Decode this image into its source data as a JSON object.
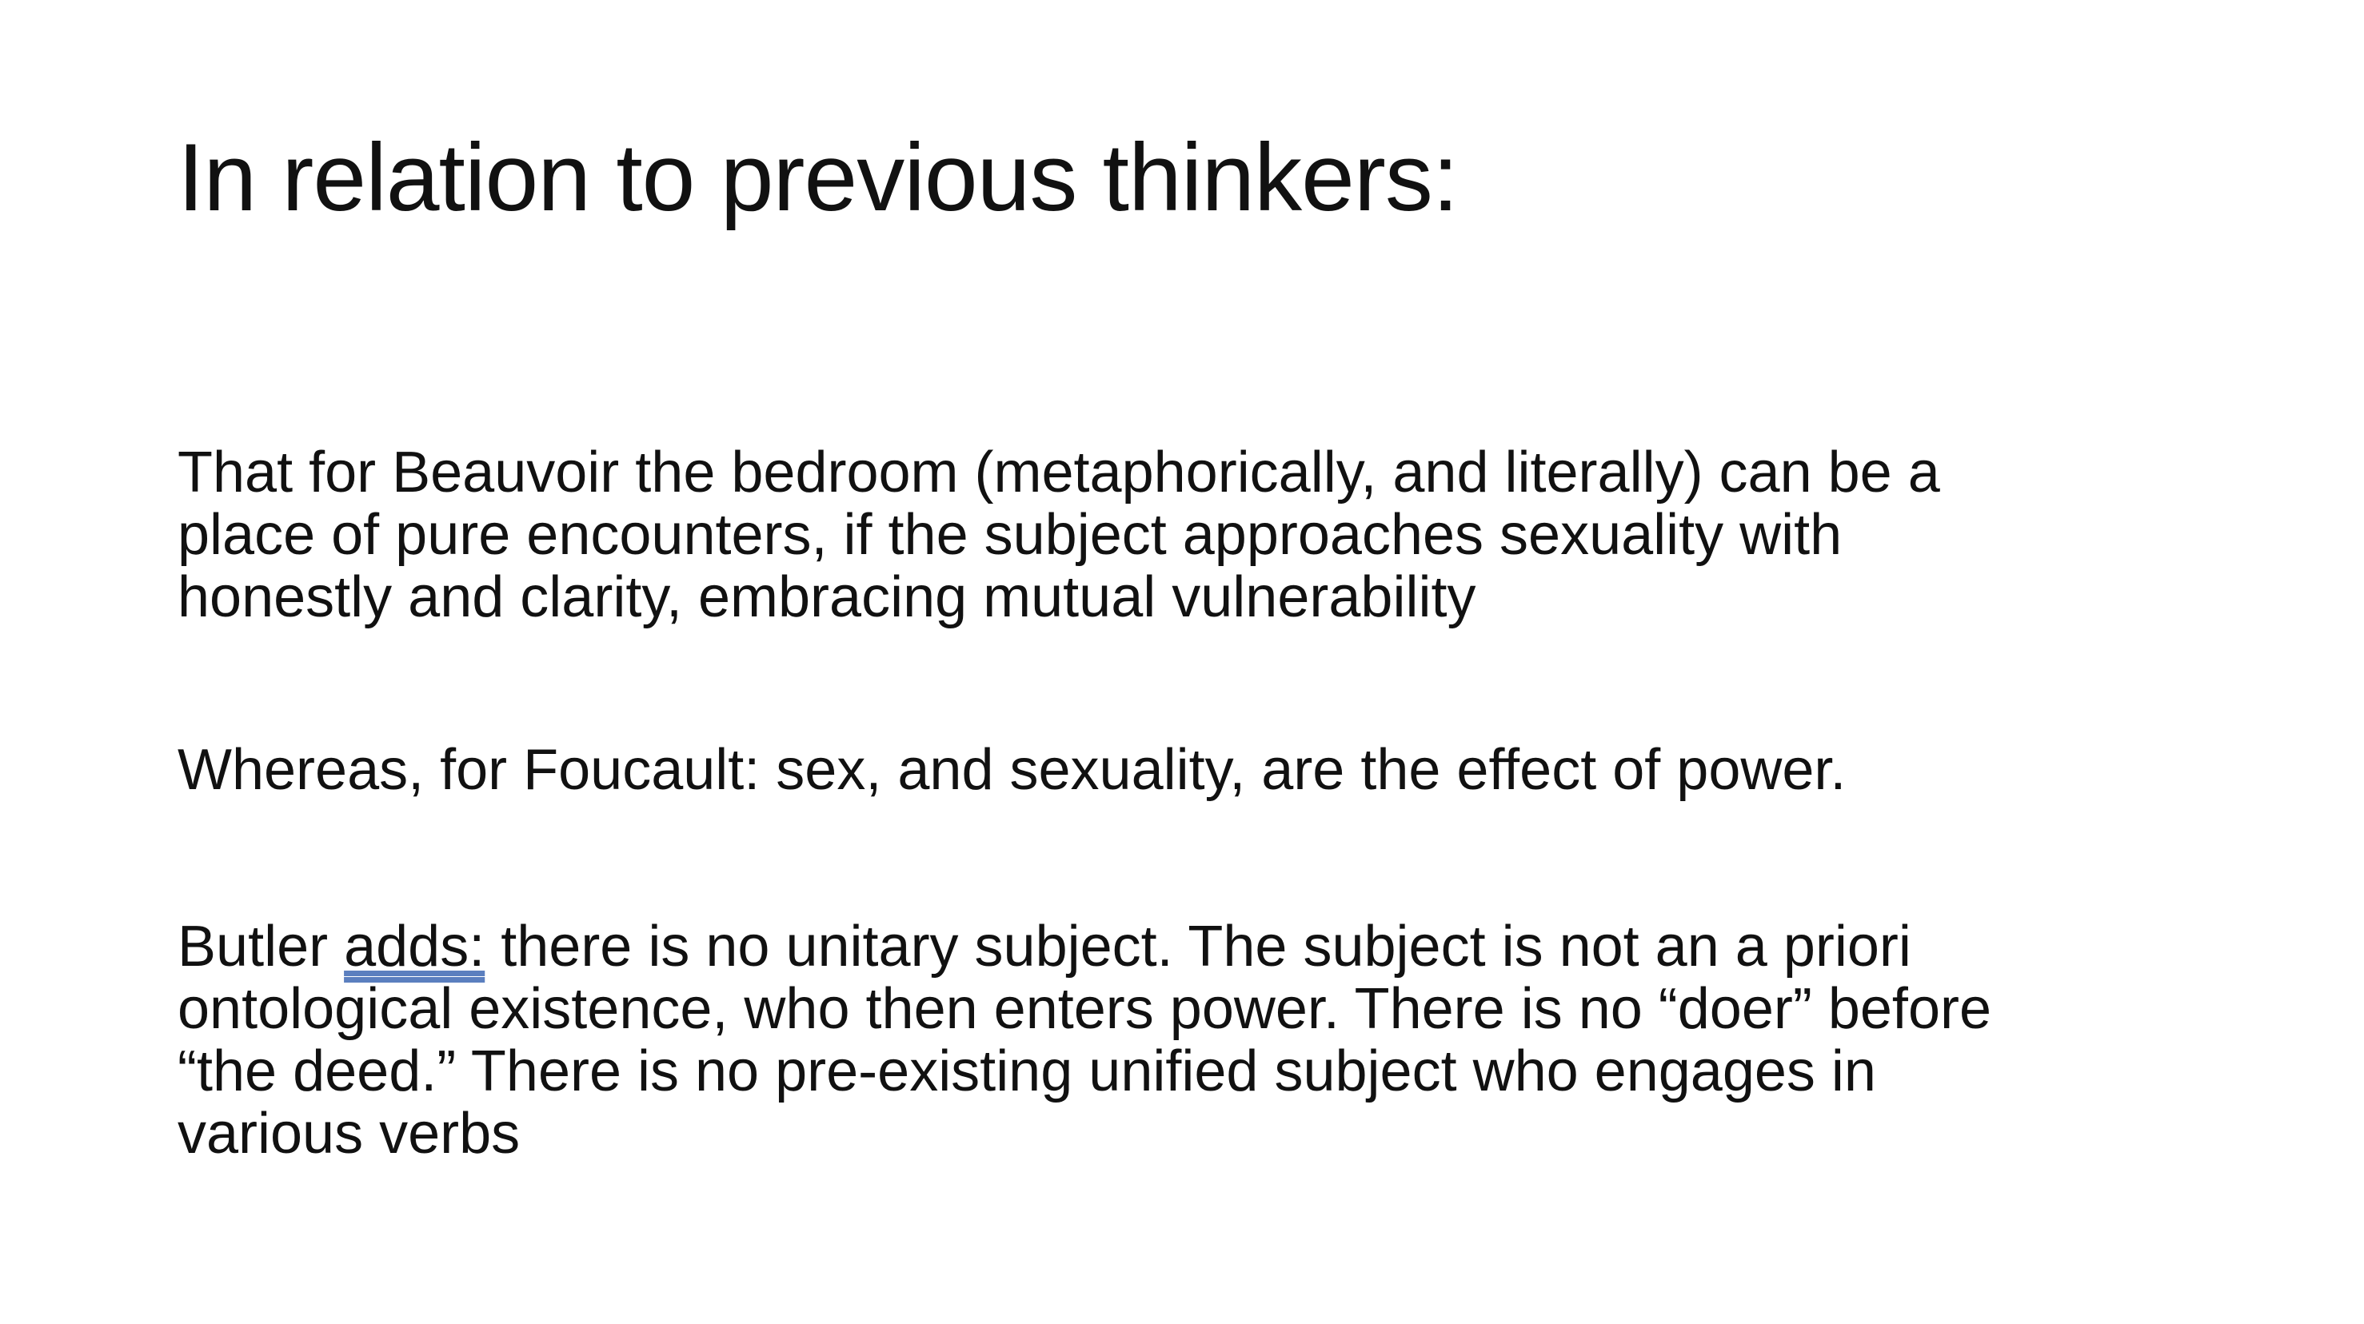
{
  "slide": {
    "title": "In relation to previous thinkers:",
    "paragraph_1": {
      "lines": [
        "That for Beauvoir the bedroom (metaphorically, and literally) can be a",
        "place of pure encounters, if the subject approaches sexuality with",
        "honestly and clarity, embracing mutual vulnerability"
      ]
    },
    "paragraph_2": {
      "text": "Whereas, for Foucault: sex, and sexuality, are the effect of power."
    },
    "paragraph_3": {
      "line1_prefix": "Butler ",
      "line1_linked": "adds:",
      "line1_suffix": " there is no unitary subject. The subject is not an a priori",
      "lines": [
        "ontological existence, who then enters power.  There is no “doer” before",
        "“the deed.” There is no pre-existing unified subject who engages in",
        "various verbs"
      ]
    }
  },
  "colors": {
    "text": "#111111",
    "background": "#ffffff",
    "link_underline": "#5b7fbf"
  }
}
